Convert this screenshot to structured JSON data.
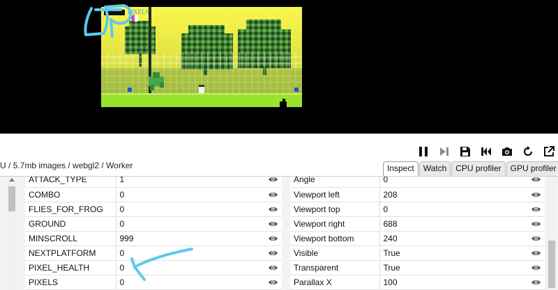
{
  "status_text": "U / 5.7mb images / webgl2 / Worker",
  "game_hud_text": "PIXELS",
  "toolbar": [
    {
      "name": "pause-icon",
      "title": "Pause"
    },
    {
      "name": "step-icon",
      "title": "Step"
    },
    {
      "name": "save-icon",
      "title": "Save"
    },
    {
      "name": "restart-icon",
      "title": "Restart"
    },
    {
      "name": "screenshot-icon",
      "title": "Screenshot"
    },
    {
      "name": "reload-icon",
      "title": "Reload"
    },
    {
      "name": "popout-icon",
      "title": "Pop out"
    }
  ],
  "tabs": [
    {
      "label": "Inspect",
      "active": true
    },
    {
      "label": "Watch",
      "active": false
    },
    {
      "label": "CPU profiler",
      "active": false
    },
    {
      "label": "GPU profiler",
      "active": false
    }
  ],
  "variables": [
    {
      "name": "ATTACK_TYPE",
      "value": "1"
    },
    {
      "name": "COMBO",
      "value": "0"
    },
    {
      "name": "FLIES_FOR_FROG",
      "value": "0"
    },
    {
      "name": "GROUND",
      "value": "0"
    },
    {
      "name": "MINSCROLL",
      "value": "999"
    },
    {
      "name": "NEXTPLATFORM",
      "value": "0"
    },
    {
      "name": "PIXEL_HEALTH",
      "value": "0"
    },
    {
      "name": "PIXELS",
      "value": "0"
    }
  ],
  "properties": [
    {
      "name": "Angle",
      "value": "0"
    },
    {
      "name": "Viewport left",
      "value": "208"
    },
    {
      "name": "Viewport top",
      "value": "0"
    },
    {
      "name": "Viewport right",
      "value": "688"
    },
    {
      "name": "Viewport bottom",
      "value": "240"
    },
    {
      "name": "Visible",
      "value": "True"
    },
    {
      "name": "Transparent",
      "value": "True"
    },
    {
      "name": "Parallax X",
      "value": "100"
    }
  ],
  "colors": {
    "annotation": "#5ec8f0",
    "grass": "#9be22e",
    "sky_top": "#f3f04a"
  }
}
